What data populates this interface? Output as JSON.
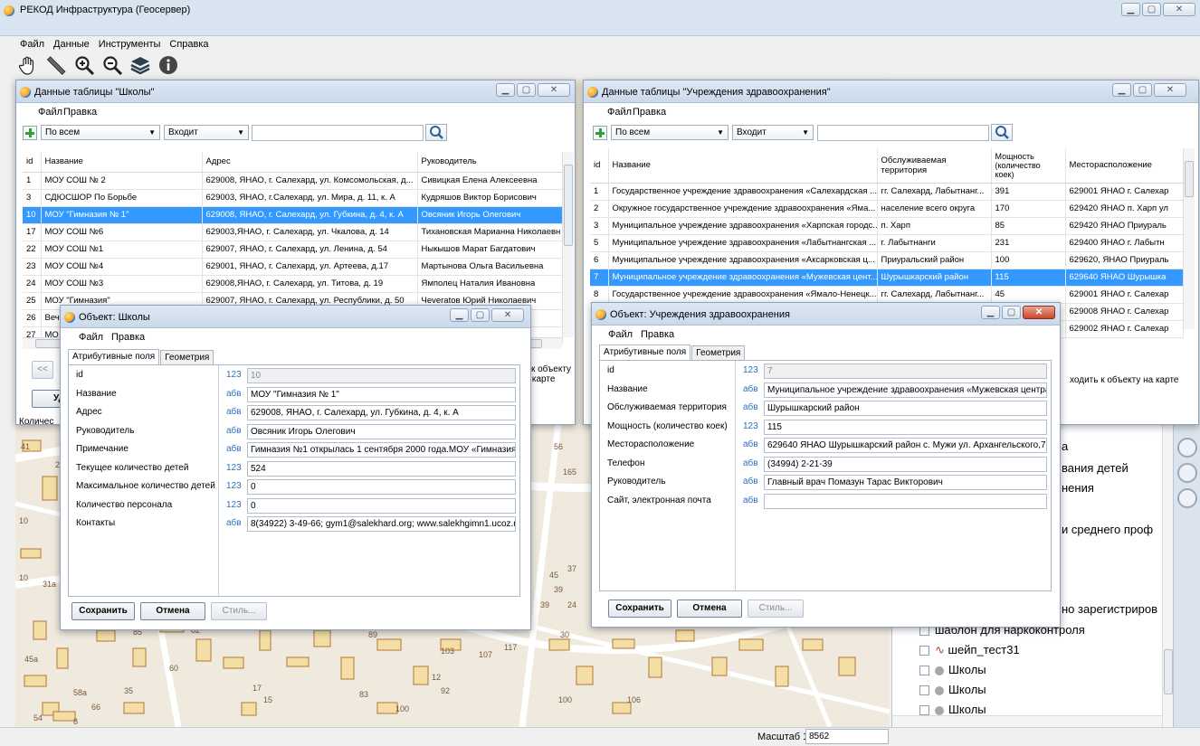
{
  "app": {
    "title": "РЕКОД Инфраструктура (Геосервер)"
  },
  "menu": [
    "Файл",
    "Данные",
    "Инструменты",
    "Справка"
  ],
  "toolbar": [
    "hand-icon",
    "ruler-icon",
    "zoom-in-icon",
    "zoom-out-icon",
    "layers-icon",
    "info-icon"
  ],
  "status": {
    "scale_label": "Масштаб 1:",
    "scale_value": "8562"
  },
  "layers_panel": {
    "items": [
      "а",
      "вания детей",
      "нения",
      "и среднего проф",
      "но зарегистриров",
      "шаблон для наркоконтроля",
      "шейп_тест31",
      "Школы",
      "Школы",
      "Школы"
    ]
  },
  "schools_table": {
    "title": "Данные таблицы \"Школы\"",
    "menu": [
      "Файл",
      "Правка"
    ],
    "filter_field": "По всем",
    "filter_op": "Входит",
    "columns": [
      "id",
      "Название",
      "Адрес",
      "Руководитель"
    ],
    "rows": [
      [
        "1",
        "МОУ СОШ № 2",
        "629008, ЯНАО, г. Салехард, ул. Комсомольская, д...",
        "Сивицкая Елена Алексеевна"
      ],
      [
        "3",
        "СДЮСШОР По Борьбе",
        "629003, ЯНАО, г.Салехард, ул. Мира, д. 11, к. А",
        "Кудряшов Виктор Борисович"
      ],
      [
        "10",
        "МОУ \"Гимназия № 1\"",
        "629008, ЯНАО, г. Салехард, ул. Губкина, д. 4, к. А",
        "Овсяник Игорь Олегович"
      ],
      [
        "17",
        "МОУ СОШ №6",
        "629003,ЯНАО, г. Салехард, ул. Чкалова, д. 14",
        "Тихановская Марианна Николаевн"
      ],
      [
        "22",
        "МОУ СОШ №1",
        "629007, ЯНАО, г. Салехард, ул. Ленина, д. 54",
        "Ныкышов Марат Багдатович"
      ],
      [
        "23",
        "МОУ СОШ №4",
        "629001, ЯНАО, г. Салехард, ул. Артеева, д.17",
        "Мартынова Ольга Васильевна"
      ],
      [
        "24",
        "МОУ СОШ №3",
        "629008,ЯНАО, г. Салехард, ул. Титова, д. 19",
        "Ямполец Наталия Ивановна"
      ],
      [
        "25",
        "МОУ \"Гимназия\"",
        "629007, ЯНАО, г. Салехард, ул. Республики, д. 50",
        "Чеveratов Юрий Николаевич"
      ],
      [
        "26",
        "Веч",
        "",
        "на"
      ],
      [
        "27",
        "МО",
        "",
        ""
      ]
    ],
    "selected_row": 2,
    "goto_text": "ти к объекту на карте",
    "nav_prev": "<<",
    "delete_partial": "Уд",
    "count_partial": "Количес"
  },
  "health_table": {
    "title": "Данные таблицы \"Учреждения здравоохранения\"",
    "menu": [
      "Файл",
      "Правка"
    ],
    "filter_field": "По всем",
    "filter_op": "Входит",
    "columns": [
      "id",
      "Название",
      "Обслуживаемая территория",
      "Мощность (количество коек)",
      "Месторасположение"
    ],
    "rows": [
      [
        "1",
        "Государственное учреждение здравоохранения «Салехардская ...",
        "гг. Салехард, Лабытнанг...",
        "391",
        "629001 ЯНАО г. Салехар"
      ],
      [
        "2",
        "Окружное государственное учреждение здравоохранения «Яма...",
        "население всего округа",
        "170",
        "629420 ЯНАО п. Харп ул"
      ],
      [
        "3",
        "Муниципальное учреждение здравоохранения «Харпская городс...",
        "п. Харп",
        "85",
        "629420 ЯНАО Приураль"
      ],
      [
        "5",
        "Муниципальное учреждение здравоохранения «Лабытнангская ...",
        "г. Лабытнанги",
        "231",
        "629400 ЯНАО г. Лабытн"
      ],
      [
        "6",
        "Муниципальное учреждение здравоохранения «Аксарковская ц...",
        "Приуральский район",
        "100",
        "629620, ЯНАО Приураль"
      ],
      [
        "7",
        "Муниципальное учреждение здравоохранения «Мужевская цент...",
        "Шурышкарский район",
        "115",
        "629640 ЯНАО Шурышка"
      ],
      [
        "8",
        "Государственное учреждение здравоохранения «Ямало-Ненецк...",
        "гг. Салехард, Лабытнанг...",
        "45",
        "629001 ЯНАО г. Салехар"
      ],
      [
        "",
        "",
        "",
        "",
        "629008 ЯНАО г. Салехар"
      ],
      [
        "",
        "",
        "",
        "",
        "629002 ЯНАО г. Салехар"
      ]
    ],
    "selected_row": 5,
    "goto_text": "ходить к объекту на карте"
  },
  "school_object": {
    "title": "Объект: Школы",
    "menu": [
      "Файл",
      "Правка"
    ],
    "tabs": [
      "Атрибутивные поля",
      "Геометрия"
    ],
    "fields": [
      {
        "label": "id",
        "type": "123",
        "value": "10",
        "disabled": true
      },
      {
        "label": "Название",
        "type": "абв",
        "value": "МОУ \"Гимназия № 1\""
      },
      {
        "label": "Адрес",
        "type": "абв",
        "value": "629008, ЯНАО, г. Салехард, ул. Губкина, д. 4, к. А"
      },
      {
        "label": "Руководитель",
        "type": "абв",
        "value": "Овсяник Игорь Олегович"
      },
      {
        "label": "Примечание",
        "type": "абв",
        "value": "Гимназия №1 открылась 1 сентября 2000 года.МОУ «Гимназия №"
      },
      {
        "label": "Текущее количество детей",
        "type": "123",
        "value": "524"
      },
      {
        "label": "Максимальное количество детей",
        "type": "123",
        "value": "0"
      },
      {
        "label": "Количество персонала",
        "type": "123",
        "value": "0"
      },
      {
        "label": "Контакты",
        "type": "абв",
        "value": "8(34922) 3-49-66; gym1@salekhard.org; www.salekhgimn1.ucoz.ru"
      }
    ],
    "buttons": {
      "save": "Сохранить",
      "cancel": "Отмена",
      "style": "Стиль..."
    }
  },
  "health_object": {
    "title": "Объект: Учреждения здравоохранения",
    "menu": [
      "Файл",
      "Правка"
    ],
    "tabs": [
      "Атрибутивные поля",
      "Геометрия"
    ],
    "fields": [
      {
        "label": "id",
        "type": "123",
        "value": "7",
        "disabled": true
      },
      {
        "label": "Название",
        "type": "абв",
        "value": "Муниципальное учреждение здравоохранения «Мужевская центральна"
      },
      {
        "label": "Обслуживаемая территория",
        "type": "абв",
        "value": "Шурышкарский район"
      },
      {
        "label": "Мощность (количество коек)",
        "type": "123",
        "value": "115"
      },
      {
        "label": "Месторасположение",
        "type": "абв",
        "value": "629640 ЯНАО Шурышкарский район с. Мужи ул. Архангельского,7"
      },
      {
        "label": "Телефон",
        "type": "абв",
        "value": "(34994) 2-21-39"
      },
      {
        "label": "Руководитель",
        "type": "абв",
        "value": "Главный врач Помазун Тарас Викторович"
      },
      {
        "label": "Сайт, электронная почта",
        "type": "абв",
        "value": ""
      }
    ],
    "buttons": {
      "save": "Сохранить",
      "cancel": "Отмена",
      "style": "Стиль..."
    }
  }
}
